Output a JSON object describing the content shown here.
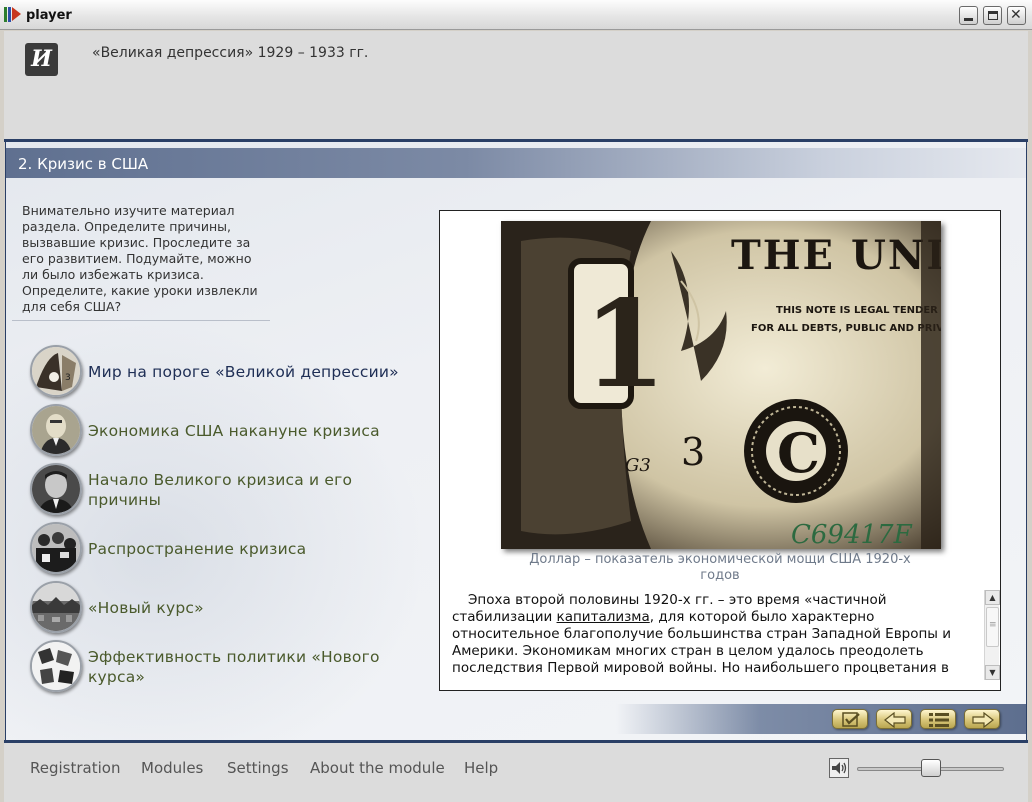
{
  "window": {
    "title": "player",
    "icon": "app-player-icon",
    "controls": [
      "minimize-icon",
      "maximize-icon",
      "close-icon"
    ]
  },
  "header": {
    "logo_letter": "И",
    "course_title": "«Великая депрессия» 1929 – 1933 гг."
  },
  "section": {
    "title": "2. Кризис в США"
  },
  "instructions": "Внимательно изучите материал раздела. Определите причины, вызвавшие кризис. Проследите за его развитием. Подумайте, можно ли было избежать кризиса. Определите, какие уроки извлекли для себя США?",
  "topics": [
    {
      "label": "Мир на пороге «Великой депрессии»",
      "active": true
    },
    {
      "label": "Экономика США накануне кризиса",
      "active": false
    },
    {
      "label": "Начало Великого кризиса и его причины",
      "active": false
    },
    {
      "label": "Распространение кризиса",
      "active": false
    },
    {
      "label": "«Новый курс»",
      "active": false
    },
    {
      "label": "Эффективность политики «Нового курса»",
      "active": false
    }
  ],
  "content": {
    "photo": {
      "banner_text": "THE UNITE",
      "legal_text_1": "THIS NOTE IS LEGAL TENDER",
      "legal_text_2": "FOR ALL DEBTS, PUBLIC AND PRIVATE",
      "denomination": "1",
      "plate": "G3",
      "number": "3",
      "seal": "C",
      "serial": "C69417F"
    },
    "caption": "Доллар – показатель экономической мощи США 1920-х годов",
    "text_before_link": "Эпоха второй половины 1920-х гг. – это время «частичной стабилизации ",
    "link_text": "капитализма",
    "text_after_link": ", для которой было характерно относительное благополучие большинства стран Западной Европы и Америки. Экономикам многих стран в целом удалось преодолеть последствия Первой мировой войны. Но наибольшего процветания в"
  },
  "navigation": {
    "buttons": [
      "checkmark-icon",
      "arrow-left-icon",
      "list-icon",
      "arrow-right-icon"
    ]
  },
  "footer": {
    "menu": [
      "Registration",
      "Modules",
      "Settings",
      "About the module",
      "Help"
    ],
    "volume": {
      "icon": "speaker-icon",
      "level": 0.5
    }
  },
  "colors": {
    "accent_dark": "#2a3f66",
    "topic_text": "#4a5a2c",
    "topic_active_text": "#1e2e55",
    "nav_button": "#d8c67a"
  }
}
